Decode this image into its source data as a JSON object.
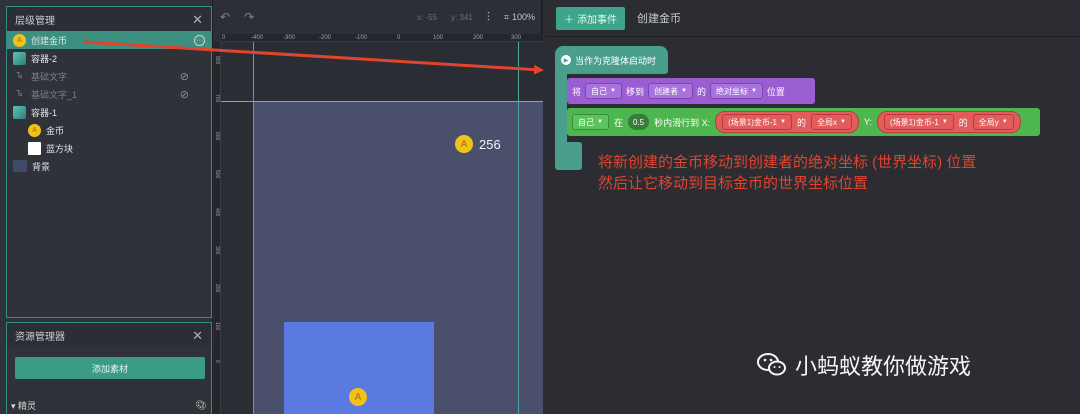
{
  "layers_panel": {
    "title": "层级管理",
    "items": [
      {
        "label": "创建金币",
        "icon": "coin-icon",
        "state": "selected"
      },
      {
        "label": "容器-2",
        "icon": "cube-icon",
        "state": "normal"
      },
      {
        "label": "基础文字",
        "icon": "text-icon",
        "state": "hidden"
      },
      {
        "label": "基础文字_1",
        "icon": "text-icon",
        "state": "hidden"
      },
      {
        "label": "容器-1",
        "icon": "cube-icon",
        "state": "normal"
      },
      {
        "label": "金币",
        "icon": "coin-icon",
        "state": "child"
      },
      {
        "label": "蓝方块",
        "icon": "square-icon",
        "state": "child"
      },
      {
        "label": "背景",
        "icon": "background-icon",
        "state": "normal"
      }
    ],
    "coin_glyph": "A"
  },
  "assets_panel": {
    "title": "资源管理器",
    "add_button": "添加素材",
    "section": "精灵"
  },
  "stage": {
    "coords_x": "x: -55",
    "coords_y": "y: 341",
    "zoom": "100%",
    "ruler_top": [
      "0",
      "-400",
      "-300",
      "-200",
      "-100",
      "0",
      "100",
      "200",
      "300"
    ],
    "ruler_left": [
      "800",
      "700",
      "600",
      "500",
      "400",
      "300",
      "200",
      "100",
      "0"
    ],
    "score": "256",
    "coin_glyph": "A"
  },
  "editor": {
    "add_event": "添加事件",
    "event_title": "创建金币",
    "hat_block": "当作为克隆体启动时",
    "move_block": {
      "w1": "将",
      "target": "自己",
      "w2": "移到",
      "ref": "创建者",
      "w3": "的",
      "coord": "绝对坐标",
      "w4": "位置"
    },
    "glide_block": {
      "target": "自己",
      "w1": "在",
      "seconds": "0.5",
      "w2": "秒内滑行到 X:",
      "x_obj": "(场景1)金币-1",
      "x_of": "的",
      "x_prop": "全局x",
      "y_label": "Y:",
      "y_obj": "(场景1)金币-1",
      "y_of": "的",
      "y_prop": "全局y"
    }
  },
  "annotation": {
    "line1": "将新创建的金币移动到创建者的绝对坐标 (世界坐标) 位置",
    "line2": "然后让它移动到目标金币的世界坐标位置"
  },
  "watermark": "小蚂蚁教你做游戏",
  "colors": {
    "accent": "#3d8f7f",
    "arrow": "#e0442f",
    "scene_bg": "#4a506c",
    "blue_block": "#5a7ae0"
  }
}
